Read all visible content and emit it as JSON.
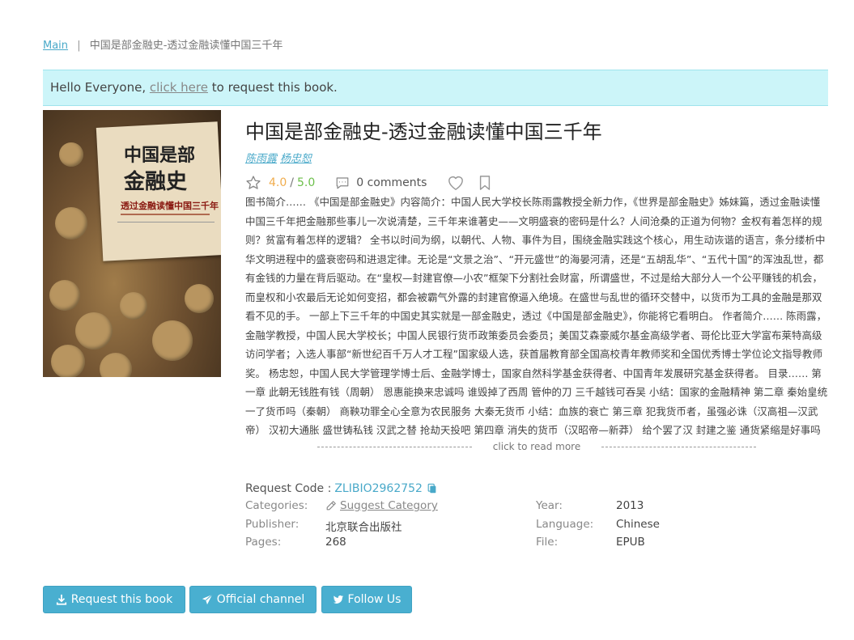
{
  "breadcrumb": {
    "home": "Main",
    "separator": "|",
    "current": "中国是部金融史-透过金融读懂中国三千年"
  },
  "notice": {
    "prefix": "Hello Everyone, ",
    "link": "click here",
    "suffix": " to request this book."
  },
  "cover": {
    "title_line1": "中国是部",
    "title_line2": "金融史",
    "subtitle": "透过金融读懂中国三千年"
  },
  "book": {
    "title": "中国是部金融史-透过金融读懂中国三千年",
    "authors": [
      "陈雨露",
      "杨忠恕"
    ],
    "rating": "4.0",
    "rating_separator": "/",
    "rating_max": "5.0",
    "comments": "0 comments",
    "description": "图书简介…… 《中国是部金融史》内容简介：中国人民大学校长陈雨露教授全新力作，《世界是部金融史》姊妹篇，透过金融读懂中国三千年把金融那些事儿一次说清楚，三千年来谁著史——文明盛衰的密码是什么？人间沧桑的正道为何物？金权有着怎样的规则？贫富有着怎样的逻辑？ 全书以时间为纲，以朝代、人物、事件为目，围绕金融实践这个核心，用生动诙谐的语言，条分缕析中华文明进程中的盛衰密码和进退定律。无论是“文景之治”、“开元盛世”的海晏河清，还是“五胡乱华”、“五代十国”的浑浊乱世，都有金钱的力量在背后驱动。在“皇权—封建官僚—小农”框架下分割社会财富，所谓盛世，不过是给大部分人一个公平赚钱的机会，而皇权和小农最后无论如何变招，都会被霸气外露的封建官僚逼入绝境。在盛世与乱世的循环交替中，以货币为工具的金融是那双看不见的手。 一部上下三千年的中国史其实就是一部金融史，透过《中国是部金融史》，你能将它看明白。 作者简介…… 陈雨露，金融学教授，中国人民大学校长；中国人民银行货币政策委员会委员；美国艾森豪威尔基金高级学者、哥伦比亚大学富布莱特高级访问学者；入选人事部“新世纪百千万人才工程”国家级人选，获首届教育部全国高校青年教师奖和全国优秀博士学位论文指导教师奖。 杨忠恕，中国人民大学管理学博士后、金融学博士，国家自然科学基金获得者、中国青年发展研究基金获得者。 目录…… 第一章 此朝无钱胜有钱（周朝） 恩惠能换来忠诚吗 谁毁掉了西周 管仲的刀 三千越钱可吞吴 小结：国家的金融精神 第二章 秦始皇统一了货币吗（秦朝） 商鞅功罪全心全意为农民服务 大秦无货币 小结：血族的衰亡 第三章 犯我货币者，虽强必诛（汉高祖—汉武帝） 汉初大通胀 盛世铸私钱 汉武之替 抢劫天投吧 第四章 消失的货币（汉昭帝—新莽） 给个罢了汉 封建之鉴 通货紧缩是好事吗 王莽末钱的腐败",
    "read_more": "click to read more"
  },
  "request": {
    "label": "Request Code :",
    "code": "ZLIBIO2962752"
  },
  "properties": {
    "categories_label": "Categories:",
    "categories_value": "Suggest Category",
    "year_label": "Year:",
    "year_value": "2013",
    "publisher_label": "Publisher:",
    "publisher_value": "北京联合出版社",
    "language_label": "Language:",
    "language_value": "Chinese",
    "pages_label": "Pages:",
    "pages_value": "268",
    "file_label": "File:",
    "file_value": "EPUB"
  },
  "buttons": {
    "request": "Request this book",
    "official": "Official channel",
    "follow": "Follow Us"
  },
  "colors": {
    "accent": "#49afd0",
    "link": "#49a9c9",
    "notice_bg": "#ccf5f9",
    "rating": "#f0ad4e",
    "rating_max": "#6cbf4a"
  }
}
